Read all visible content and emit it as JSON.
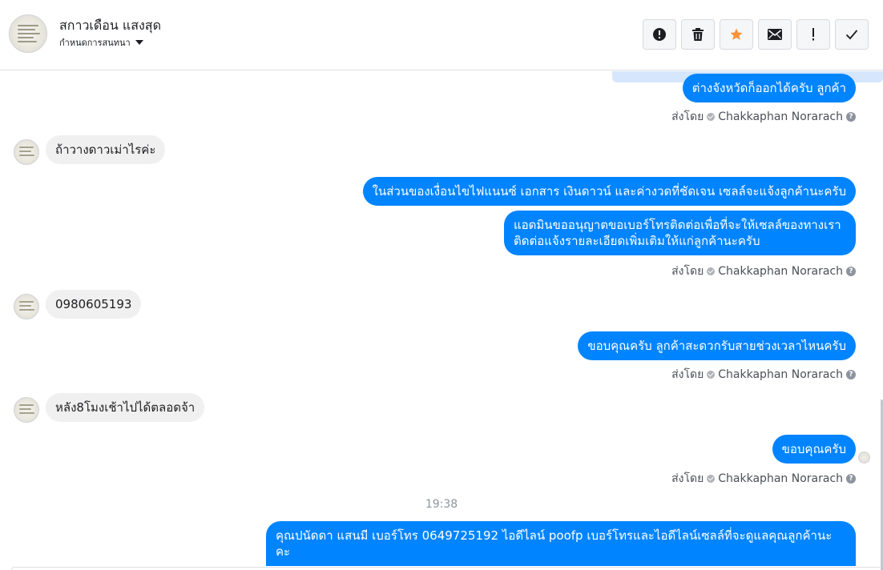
{
  "header": {
    "contact_name": "สกาวเดือน แสงสุด",
    "assign_label": "กำหนดการสนทนา",
    "toolbar": [
      {
        "name": "report-spam-button",
        "icon": "alert-circle-icon"
      },
      {
        "name": "delete-button",
        "icon": "trash-icon"
      },
      {
        "name": "star-button",
        "icon": "star-icon",
        "color": "#f7923b"
      },
      {
        "name": "mark-unread-button",
        "icon": "envelope-icon"
      },
      {
        "name": "follow-up-button",
        "icon": "exclamation-icon"
      },
      {
        "name": "mark-done-button",
        "icon": "check-icon"
      }
    ]
  },
  "colors": {
    "outgoing_bubble": "#0084ff",
    "incoming_bubble": "#f1f0f0",
    "star": "#f7923b"
  },
  "messages": [
    {
      "direction": "out",
      "text": "ต่างจังหวัดก็ออกได้ครับ ลูกค้า"
    },
    {
      "direction": "in",
      "text": "ถ้าวางดาวเม่าไรค่ะ"
    },
    {
      "direction": "out",
      "text": "ในส่วนของเงื่อนไขไฟแนนซ์ เอกสาร เงินดาวน์ และค่างวดที่ชัดเจน เซลล์จะแจ้งลูกค้านะครับ"
    },
    {
      "direction": "out",
      "text": "แอดมินขออนุญาตขอเบอร์โทรติดต่อเพื่อที่จะให้เซลล์ของทางเรา ติดต่อแจ้งรายละเอียดเพิ่มเติมให้แก่ลูกค้านะครับ"
    },
    {
      "direction": "in",
      "text": "0980605193"
    },
    {
      "direction": "out",
      "text": "ขอบคุณครับ ลูกค้าสะดวกรับสายช่วงเวลาไหนครับ"
    },
    {
      "direction": "in",
      "text": "หลัง8โมงเช้าไปได้ตลอดจ้า"
    },
    {
      "direction": "out",
      "text": "ขอบคุณครับ"
    },
    {
      "direction": "out",
      "text": "คุณปนัดดา แสนมี   เบอร์โทร 0649725192  ไอดีไลน์ poofp  เบอร์โทรและไอดีไลน์เซลล์ที่จะดูแลคุณลูกค้านะคะ"
    }
  ],
  "sent_by": {
    "prefix": "ส่งโดย",
    "agent": "Chakkaphan Norarach",
    "help": "?"
  },
  "timestamp": "19:38"
}
